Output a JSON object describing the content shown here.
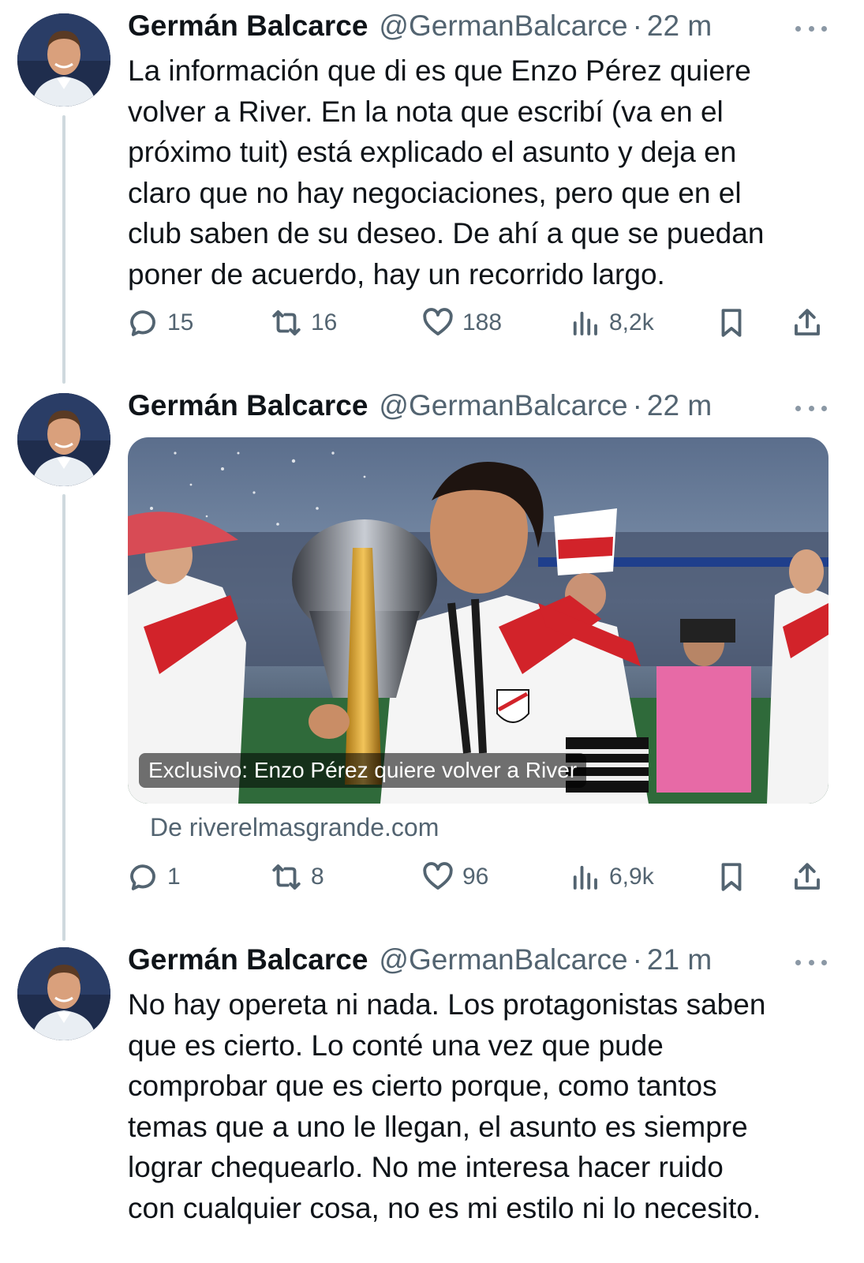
{
  "tweets": [
    {
      "name": "Germán Balcarce",
      "handle": "@GermanBalcarce",
      "separator": "·",
      "time": "22 m",
      "text": "La información que di es que Enzo Pérez quiere volver a River. En la nota que escribí (va en el próximo tuit) está explicado el asunto y deja en claro que no hay negociaciones, pero que en el club saben de su deseo. De ahí a que se puedan poner de acuerdo, hay un recorrido largo.",
      "lines": [
        "La información que di es que Enzo Pérez quiere",
        "volver a River. En la nota que escribí (va en el",
        "próximo tuit) está explicado el asunto y deja en",
        "claro que no hay negociaciones, pero que en el",
        "club saben de su deseo. De ahí a que se puedan",
        "poner de acuerdo, hay un recorrido largo."
      ],
      "replies": "15",
      "retweets": "16",
      "likes": "188",
      "views": "8,2k"
    },
    {
      "name": "Germán Balcarce",
      "handle": "@GermanBalcarce",
      "separator": "·",
      "time": "22 m",
      "card": {
        "caption": "Exclusivo: Enzo Pérez quiere volver a River",
        "source": "De riverelmasgrande.com"
      },
      "replies": "1",
      "retweets": "8",
      "likes": "96",
      "views": "6,9k"
    },
    {
      "name": "Germán Balcarce",
      "handle": "@GermanBalcarce",
      "separator": "·",
      "time": "21 m",
      "lines": [
        "No hay opereta ni nada. Los protagonistas saben",
        "que es cierto. Lo conté una vez que pude",
        "comprobar que es cierto porque, como tantos",
        "temas que a uno le llegan, el asunto es siempre",
        "lograr chequearlo. No me interesa hacer ruido",
        "con cualquier cosa, no es mi estilo ni lo necesito."
      ]
    }
  ],
  "icons": {
    "reply": "reply-icon",
    "retweet": "retweet-icon",
    "like": "heart-icon",
    "views": "views-icon",
    "bookmark": "bookmark-icon",
    "share": "share-icon",
    "more": "more-icon"
  },
  "colors": {
    "text": "#0f1419",
    "secondary": "#536471",
    "thread_line": "#cfd9de",
    "river_red": "#d2232a"
  }
}
